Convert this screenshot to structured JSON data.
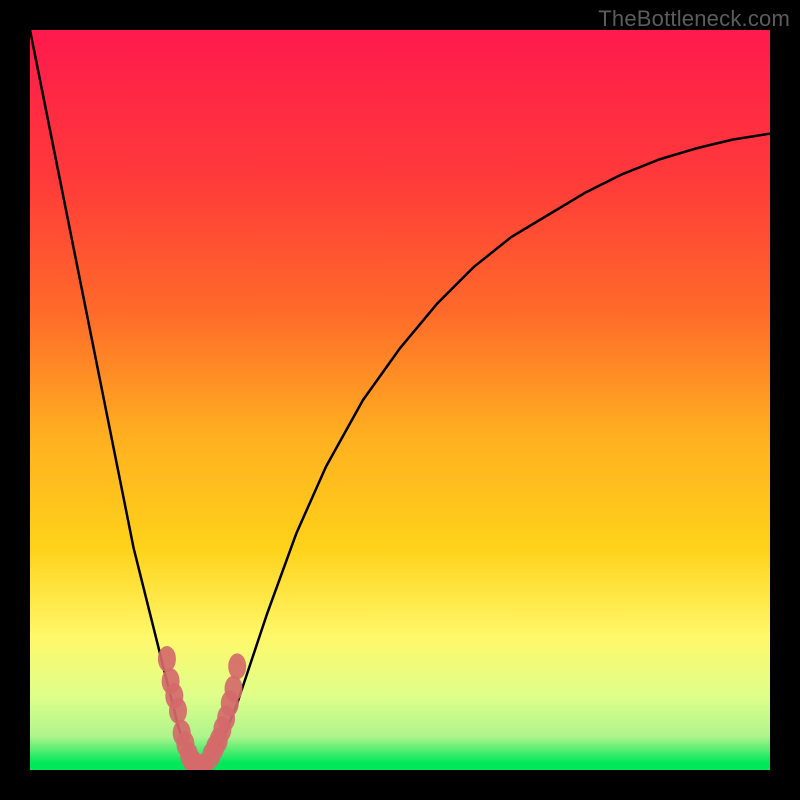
{
  "watermark": "TheBottleneck.com",
  "colors": {
    "frame": "#000000",
    "gradient_top": "#ff1a4d",
    "gradient_mid_upper": "#ff6a2a",
    "gradient_mid": "#ffd21a",
    "gradient_mid_lower": "#fff86a",
    "gradient_lower": "#dfff8a",
    "gradient_bottom": "#00e85a",
    "curve": "#000000",
    "points": "#d46a6a"
  },
  "chart_data": {
    "type": "line",
    "title": "",
    "xlabel": "",
    "ylabel": "",
    "xlim": [
      0,
      100
    ],
    "ylim": [
      0,
      100
    ],
    "series": [
      {
        "name": "bottleneck-curve",
        "x": [
          0,
          2,
          4,
          6,
          8,
          10,
          12,
          14,
          16,
          18,
          20,
          21,
          22,
          23,
          24,
          26,
          28,
          30,
          32,
          36,
          40,
          45,
          50,
          55,
          60,
          65,
          70,
          75,
          80,
          85,
          90,
          95,
          100
        ],
        "y": [
          100,
          90,
          80,
          70,
          60,
          50,
          40,
          30,
          22,
          14,
          6,
          3,
          1,
          0,
          1,
          4,
          9,
          15,
          21,
          32,
          41,
          50,
          57,
          63,
          68,
          72,
          75,
          78,
          80.5,
          82.5,
          84,
          85.2,
          86
        ]
      }
    ],
    "points": {
      "name": "sample-points",
      "x": [
        18.5,
        19,
        19.5,
        20,
        20.5,
        21,
        21.5,
        22,
        22.5,
        23,
        23.5,
        24.5,
        25,
        25.5,
        26,
        26.5,
        27,
        27.5,
        28
      ],
      "y": [
        15,
        12,
        10,
        8,
        5,
        3.5,
        2,
        1,
        0.5,
        0.3,
        0.5,
        2,
        3,
        4,
        5.5,
        7,
        9,
        11,
        14
      ]
    }
  }
}
